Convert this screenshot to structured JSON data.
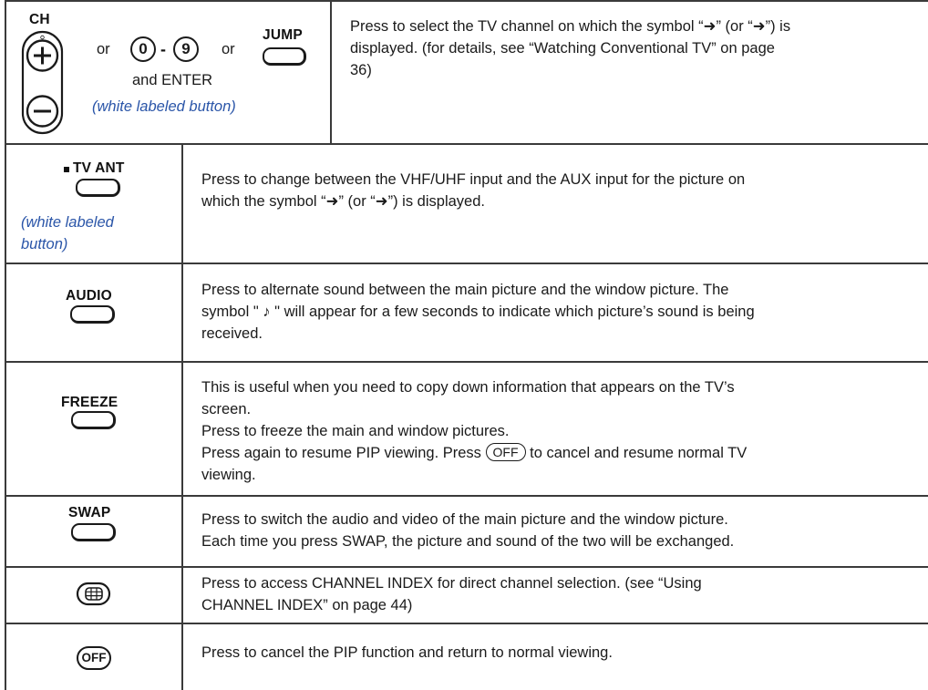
{
  "rows": [
    {
      "labels": {
        "ch": "CH",
        "or1": "or",
        "digit0": "0",
        "dash": "-",
        "digit9": "9",
        "or2": "or",
        "jump": "JUMP",
        "enter": "and ENTER"
      },
      "note": "(white labeled button)",
      "description": [
        "Press to select the TV channel on which the symbol “➜” (or “➜”) is",
        "displayed. (for details, see “Watching Conventional TV” on page",
        "36)"
      ]
    },
    {
      "label": "TV ANT",
      "note": [
        "(white labeled",
        "button)"
      ],
      "description": [
        "Press to change between the VHF/UHF input and the AUX input for the picture on",
        "which the symbol “➜” (or “➜”) is displayed."
      ]
    },
    {
      "label": "AUDIO",
      "description": [
        "Press to alternate sound between the main picture and the window picture. The",
        "symbol \" ♪ \"  will appear for a few seconds to indicate which picture’s sound is being",
        "received."
      ]
    },
    {
      "label": "FREEZE",
      "description": [
        "This is useful when you need to copy down information that appears on the TV’s",
        "screen.",
        "Press to freeze the main and window pictures.",
        "Press again to resume PIP viewing. Press",
        "to cancel and resume normal TV",
        "viewing."
      ],
      "off_inline": "OFF"
    },
    {
      "label": "SWAP",
      "description": [
        "Press to switch the audio and video of the main picture and the window picture.",
        "Each time you press SWAP, the picture and sound of the two will be exchanged."
      ]
    },
    {
      "icon": "channel-index-icon",
      "description": [
        "Press to access CHANNEL INDEX for direct channel selection. (see “Using",
        "CHANNEL INDEX” on page 44)"
      ]
    },
    {
      "icon_label": "OFF",
      "description": [
        "Press to cancel the PIP function and return to normal viewing."
      ]
    }
  ]
}
